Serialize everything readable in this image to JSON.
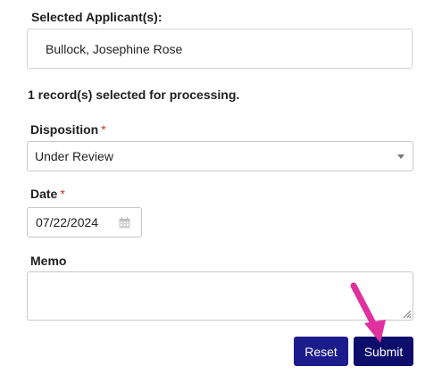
{
  "applicants": {
    "label": "Selected Applicant(s):",
    "value": "Bullock, Josephine Rose"
  },
  "status_text": "1 record(s) selected for processing.",
  "disposition": {
    "label": "Disposition",
    "required_mark": "*",
    "selected": "Under Review"
  },
  "date": {
    "label": "Date",
    "required_mark": "*",
    "value": "07/22/2024"
  },
  "memo": {
    "label": "Memo",
    "value": ""
  },
  "buttons": {
    "reset_label": "Reset",
    "submit_label": "Submit"
  },
  "colors": {
    "button_primary": "#1c1c8c",
    "button_submit": "#0d0d6b",
    "required": "#c0392b",
    "pointer_arrow": "#e0309e"
  },
  "icons": {
    "calendar": "calendar-icon",
    "dropdown": "chevron-down-icon",
    "resize": "resize-grip-icon",
    "annotation": "pointer-arrow-icon"
  }
}
